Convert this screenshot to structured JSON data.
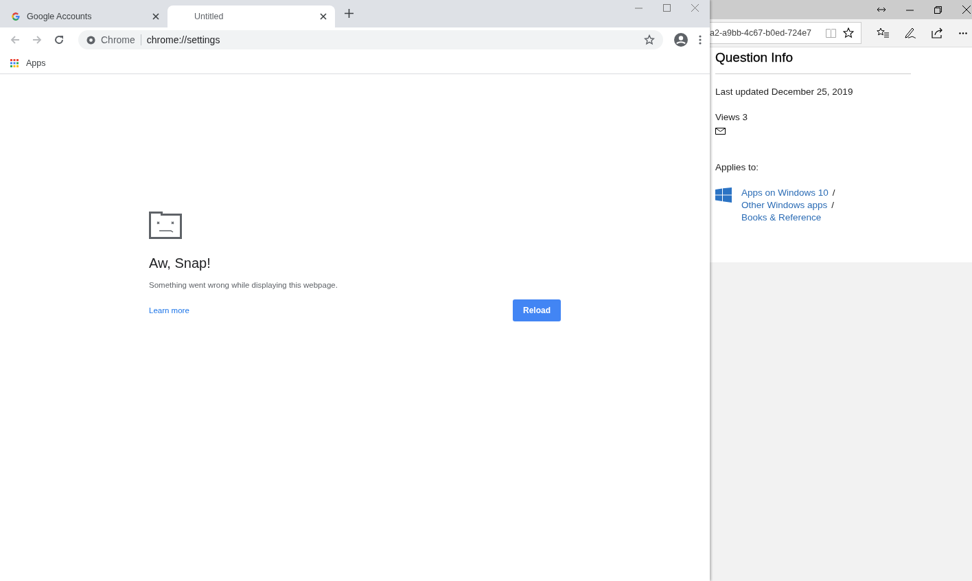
{
  "chrome_window": {
    "tabs": [
      {
        "title": "Google Accounts",
        "selected": false,
        "kind": "google"
      },
      {
        "title": "Untitled",
        "selected": true,
        "kind": "blank"
      }
    ],
    "address_bar": {
      "site_label": "Chrome",
      "url": "chrome://settings"
    },
    "bookmarks": [
      {
        "label": "Apps"
      }
    ],
    "error_page": {
      "title": "Aw, Snap!",
      "message": "Something went wrong while displaying this webpage.",
      "link": "Learn more",
      "button": "Reload"
    }
  },
  "edge_window": {
    "address_bar": {
      "url": "a2-a9bb-4c67-b0ed-724e7"
    },
    "panel": {
      "title": "Question Info",
      "last_updated": "Last updated December 25, 2019",
      "views": "Views 3",
      "applies_to_label": "Applies to:",
      "categories": [
        {
          "label": "Apps on Windows 10",
          "separator": "/"
        },
        {
          "label": "Other Windows apps",
          "separator": "/"
        },
        {
          "label": "Books & Reference"
        }
      ]
    }
  }
}
